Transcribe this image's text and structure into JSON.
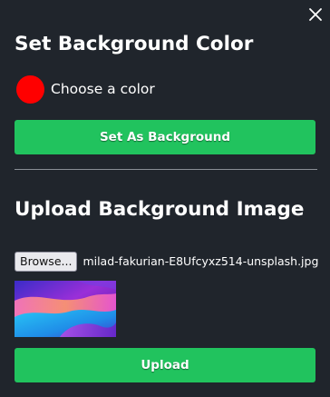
{
  "dialog": {
    "close_icon": "close-icon"
  },
  "color_section": {
    "title": "Set Background Color",
    "selected_color": "#ff0000",
    "choose_label": "Choose a color",
    "set_button_label": "Set As Background"
  },
  "image_section": {
    "title": "Upload Background Image",
    "browse_label": "Browse...",
    "file_name": "milad-fakurian-E8Ufcyxz514-unsplash.jpg",
    "upload_button_label": "Upload"
  },
  "colors": {
    "background": "#20252c",
    "accent_green": "#21c35e",
    "text": "#ffffff",
    "divider": "#8a8f96"
  }
}
